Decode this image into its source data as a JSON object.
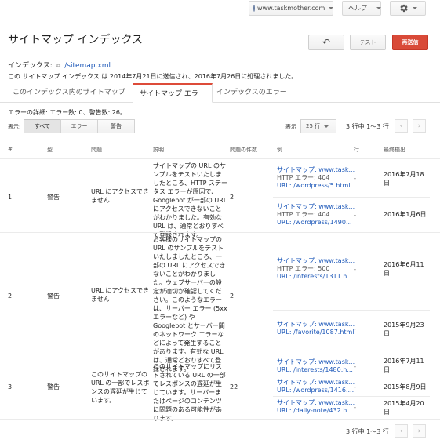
{
  "topbar": {
    "site": "www.taskmother.com",
    "help": "ヘルプ"
  },
  "header": {
    "title": "サイトマップ インデックス",
    "back_label": "↶",
    "test_label": "テスト",
    "resubmit_label": "再送信"
  },
  "index": {
    "label": "インデックス:",
    "link": "/sitemap.xml",
    "description": "この サイトマップ インデックス は 2014年7月21日に送信され、2016年7月26日に処理されました。"
  },
  "tabs": [
    {
      "label": "このインデックス内のサイトマップ"
    },
    {
      "label": "サイトマップ エラー"
    },
    {
      "label": "インデックスのエラー"
    }
  ],
  "error_detail": "エラーの詳細: エラー数: 0、警告数: 26。",
  "filter": {
    "label": "表示:",
    "options": [
      "すべて",
      "エラー",
      "警告"
    ]
  },
  "pager": {
    "show_label": "表示",
    "rows_value": "25 行",
    "range": "3 行中 1〜3 行"
  },
  "columns": [
    "#",
    "型",
    "問題",
    "説明",
    "問題の件数",
    "例",
    "行",
    "最終検出"
  ],
  "rows": [
    {
      "num": "1",
      "type": "警告",
      "issue": "URL にアクセスできません",
      "description": "サイトマップの URL のサンプルをテストいたしましたところ、HTTP ステータス エラーが原因で、Googlebot が一部の URL にアクセスできないことがわかりました。有効な URL は、通常どおりすべて登録されます。",
      "count": "2",
      "examples": [
        {
          "sitemap": "サイトマップ: www.task...",
          "status": "HTTP エラー: 404",
          "url": "URL: /wordpress/5.html",
          "line": "-",
          "date": "2016年7月18日"
        },
        {
          "sitemap": "サイトマップ: www.task...",
          "status": "HTTP エラー: 404",
          "url": "URL: /wordpress/1490...",
          "line": "-",
          "date": "2016年1月6日"
        }
      ]
    },
    {
      "num": "2",
      "type": "警告",
      "issue": "URL にアクセスできません",
      "description": "お客様のサイトマップの URL のサンプルをテストいたしましたところ、一部の URL にアクセスできないことがわかりました。ウェブサーバーの設定が適切か確認してください。このようなエラーは、サーバー エラー (5xx エラーなど) や Googlebot とサーバー間のネットワーク エラーなどによって発生することがあります。有効な URL は、通常どおりすべて登録されます。",
      "count": "2",
      "examples": [
        {
          "sitemap": "サイトマップ: www.task...",
          "status": "HTTP エラー: 500",
          "url": "URL: /interests/1311.h...",
          "line": "-",
          "date": "2016年6月11日"
        },
        {
          "sitemap": "サイトマップ: www.task...",
          "status": "",
          "url": "URL: /favorite/1087.html",
          "line": "-",
          "date": "2015年9月23日"
        }
      ]
    },
    {
      "num": "3",
      "type": "警告",
      "issue": "このサイトマップの URL の一部でレスポンスの遅延が生じています。",
      "description": "このサイトマップにリストされている URL の一部でレスポンスの遅延が生じています。サーバーまたはページのコンテンツに問題のある可能性があります。",
      "count": "22",
      "examples": [
        {
          "sitemap": "サイトマップ: www.task...",
          "status": "",
          "url": "URL: /interests/1480.h...",
          "line": "-",
          "date": "2016年7月11日"
        },
        {
          "sitemap": "サイトマップ: www.task...",
          "status": "",
          "url": "URL: /wordpress/1416....",
          "line": "-",
          "date": "2015年8月9日"
        },
        {
          "sitemap": "サイトマップ: www.task...",
          "status": "",
          "url": "URL: /daily-note/432.h...",
          "line": "-",
          "date": "2015年4月20日"
        }
      ]
    }
  ],
  "footer_range": "3 行中 1〜3 行"
}
